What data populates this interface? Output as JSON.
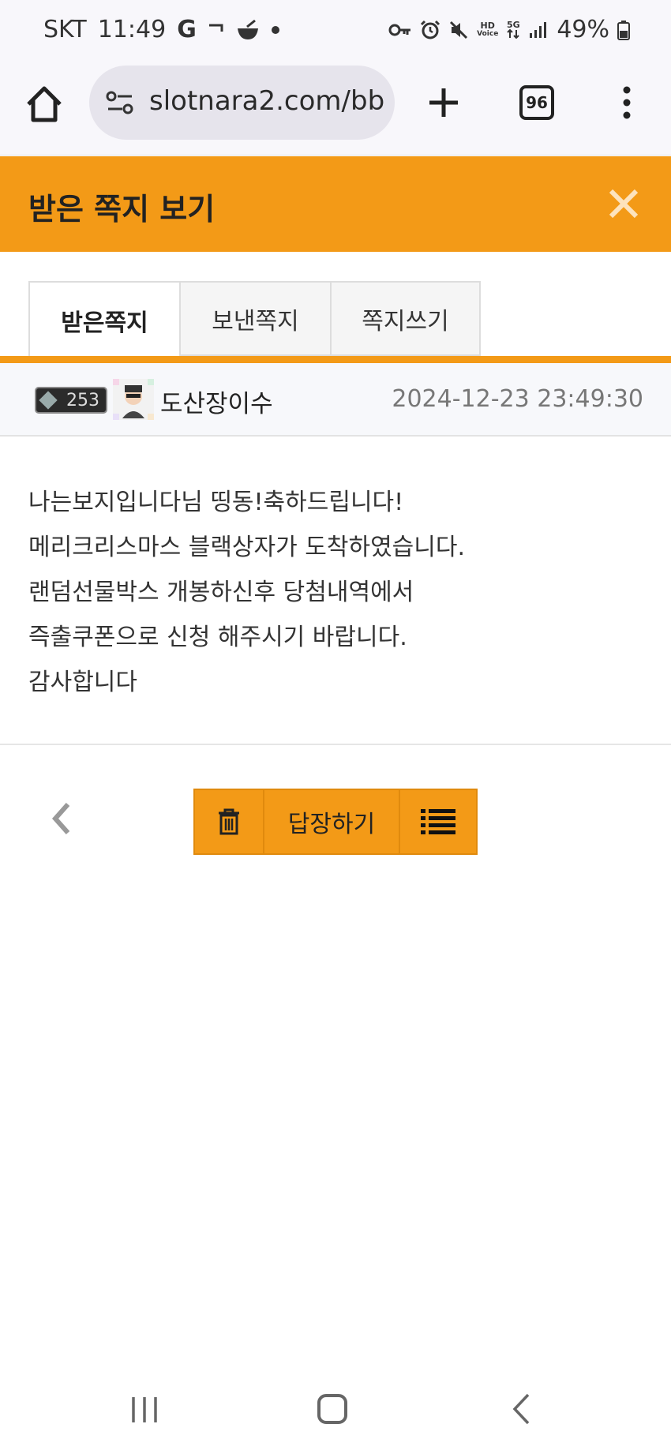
{
  "status_bar": {
    "carrier": "SKT",
    "time": "11:49",
    "battery": "49%",
    "left_icons": [
      "google-icon",
      "chat-icon",
      "food-bowl-icon",
      "dot-icon"
    ],
    "right_icons": [
      "key-icon",
      "alarm-icon",
      "mute-icon",
      "hd-voice-icon",
      "5g-icon",
      "signal-icon",
      "battery-icon"
    ],
    "hd_label": "HD",
    "voice_label": "Voice",
    "network_label": "5G"
  },
  "browser": {
    "url": "slotnara2.com/bb",
    "tab_count": "96"
  },
  "header": {
    "title": "받은 쪽지 보기",
    "accent_color": "#f39a17"
  },
  "tabs": [
    {
      "label": "받은쪽지",
      "active": true
    },
    {
      "label": "보낸쪽지",
      "active": false
    },
    {
      "label": "쪽지쓰기",
      "active": false
    }
  ],
  "sender": {
    "level": "253",
    "name": "도산장이수",
    "date": "2024-12-23 23:49:30"
  },
  "message": {
    "lines": [
      "나는보지입니다님 띵동!축하드립니다!",
      "메리크리스마스 블랙상자가 도착하였습니다.",
      "랜덤선물박스 개봉하신후 당첨내역에서",
      "즉출쿠폰으로 신청 해주시기 바랍니다.",
      "감사합니다"
    ]
  },
  "actions": {
    "reply_label": "답장하기"
  }
}
